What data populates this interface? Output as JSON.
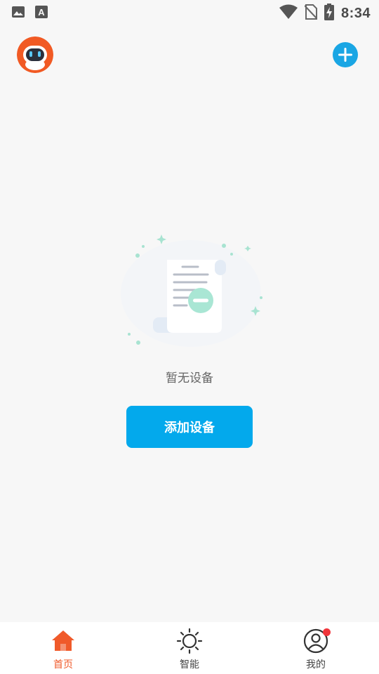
{
  "status_bar": {
    "time": "8:34",
    "icons": [
      "gallery-icon",
      "font-a-icon",
      "wifi-icon",
      "no-sim-icon",
      "battery-charging-icon"
    ]
  },
  "header": {
    "avatar_icon": "robot-mascot-icon",
    "add_icon": "plus-circle-icon",
    "accent_color": "#1aa6e4"
  },
  "empty_state": {
    "illustration_icon": "empty-document-icon",
    "message": "暂无设备",
    "button_label": "添加设备",
    "button_color": "#03a9ec"
  },
  "tabbar": {
    "active_color": "#f05a2a",
    "tabs": [
      {
        "label": "首页",
        "icon": "home-icon",
        "active": true
      },
      {
        "label": "智能",
        "icon": "sun-icon",
        "active": false
      },
      {
        "label": "我的",
        "icon": "user-icon",
        "active": false,
        "badge": true
      }
    ]
  }
}
